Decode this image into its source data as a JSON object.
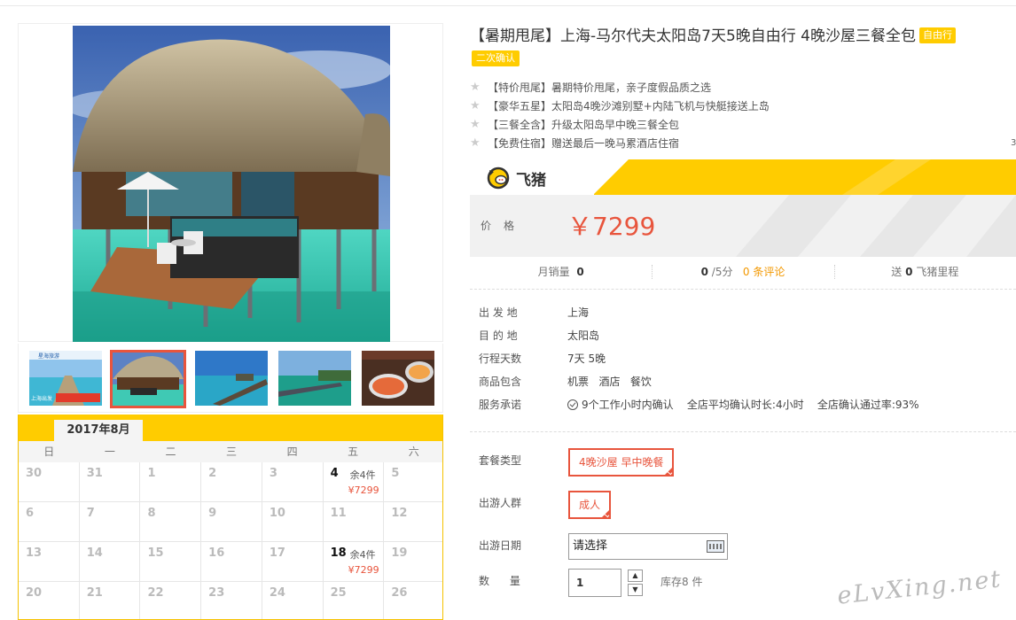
{
  "product": {
    "title": "【暑期甩尾】上海-马尔代夫太阳岛7天5晚自由行 4晚沙屋三餐全包",
    "tag_primary": "自由行",
    "tag_secondary": "二次确认",
    "features": [
      "【特价甩尾】暑期特价甩尾，亲子度假品质之选",
      "【豪华五星】太阳岛4晚沙滩别墅+内陆飞机与快艇接送上岛",
      "【三餐全含】升级太阳岛早中晚三餐全包",
      "【免费住宿】赠送最后一晚马累酒店住宿"
    ]
  },
  "brand": {
    "name": "飞猪",
    "color": "#ffcc00"
  },
  "price": {
    "label": "价格",
    "value": "￥7299",
    "color": "#e8553d"
  },
  "stats": {
    "monthly_sales_label": "月销量",
    "monthly_sales": "0",
    "rating": "0",
    "rating_suffix": "/5分",
    "reviews": "0 条评论",
    "miles_prefix": "送",
    "miles": "0",
    "miles_suffix": "飞猪里程"
  },
  "info": {
    "rows": [
      {
        "label": "出 发 地",
        "value": "上海"
      },
      {
        "label": "目 的 地",
        "value": "太阳岛"
      },
      {
        "label": "行程天数",
        "value": "7天 5晚"
      },
      {
        "label": "商品包含",
        "value": "机票   酒店   餐饮"
      }
    ],
    "service_label": "服务承诺",
    "service_items": [
      "9个工作小时内确认",
      "全店平均确认时长:4小时",
      "全店确认通过率:93%"
    ]
  },
  "options": {
    "package_label": "套餐类型",
    "package_value": "4晚沙屋 早中晚餐",
    "people_label": "出游人群",
    "people_value": "成人",
    "date_label": "出游日期",
    "date_placeholder": "请选择",
    "qty_label": "数      量",
    "qty_value": "1",
    "qty_up": "▲",
    "qty_down": "▼",
    "stock": "库存8 件"
  },
  "calendar": {
    "month": "2017年8月",
    "weekdays": [
      "日",
      "一",
      "二",
      "三",
      "四",
      "五",
      "六"
    ],
    "rows": [
      [
        {
          "d": "30"
        },
        {
          "d": "31"
        },
        {
          "d": "1"
        },
        {
          "d": "2"
        },
        {
          "d": "3"
        },
        {
          "d": "4",
          "stock": "余4件",
          "price": "¥7299"
        },
        {
          "d": "5"
        }
      ],
      [
        {
          "d": "6"
        },
        {
          "d": "7"
        },
        {
          "d": "8"
        },
        {
          "d": "9"
        },
        {
          "d": "10"
        },
        {
          "d": "11"
        },
        {
          "d": "12"
        }
      ],
      [
        {
          "d": "13"
        },
        {
          "d": "14"
        },
        {
          "d": "15"
        },
        {
          "d": "16"
        },
        {
          "d": "17"
        },
        {
          "d": "18",
          "stock": "余4件",
          "price": "¥7299"
        },
        {
          "d": "19"
        }
      ],
      [
        {
          "d": "20"
        },
        {
          "d": "21"
        },
        {
          "d": "22"
        },
        {
          "d": "23"
        },
        {
          "d": "24"
        },
        {
          "d": "25"
        },
        {
          "d": "26"
        }
      ]
    ]
  },
  "thumbs": [
    {
      "name": "thumb-pier-banner",
      "caption_top": "星海旅游",
      "caption": "上海出发"
    },
    {
      "name": "thumb-water-villa"
    },
    {
      "name": "thumb-pier-sunset"
    },
    {
      "name": "thumb-island-jetty"
    },
    {
      "name": "thumb-seafood-buffet"
    }
  ],
  "watermark": "eLvXing.net",
  "edge_char": "3"
}
